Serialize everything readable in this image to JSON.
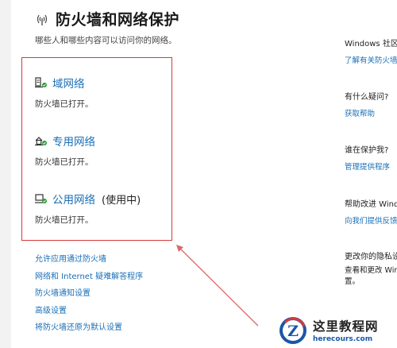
{
  "header": {
    "icon": "wifi-signal-icon",
    "title": "防火墙和网络保护",
    "subtitle": "哪些人和哪些内容可以访问你的网络。"
  },
  "networks": [
    {
      "icon": "domain-network-icon",
      "name": "域网络",
      "extra": "",
      "status": "防火墙已打开。"
    },
    {
      "icon": "private-network-icon",
      "name": "专用网络",
      "extra": "",
      "status": "防火墙已打开。"
    },
    {
      "icon": "public-network-icon",
      "name": "公用网络",
      "extra": "(使用中)",
      "status": "防火墙已打开。"
    }
  ],
  "links": [
    "允许应用通过防火墙",
    "网络和 Internet 疑难解答程序",
    "防火墙通知设置",
    "高级设置",
    "将防火墙还原为默认设置"
  ],
  "right_column": {
    "community": {
      "title": "Windows 社区",
      "link": "了解有关防火墙"
    },
    "question": {
      "title": "有什么疑问?",
      "link": "获取帮助"
    },
    "protector": {
      "title": "谁在保护我?",
      "link": "管理提供程序"
    },
    "improve": {
      "title": "帮助改进 Windows",
      "link": "向我们提供反馈"
    },
    "privacy": {
      "title": "更改你的隐私设置",
      "text": "查看和更改 Windows 设置。"
    }
  },
  "watermark": {
    "main": "这里教程网",
    "sub": "herecours.com",
    "logo_letter": "Z"
  },
  "colors": {
    "link": "#1a6fb6",
    "highlight_box": "#d63b3b",
    "arrow": "#d96a6a"
  }
}
